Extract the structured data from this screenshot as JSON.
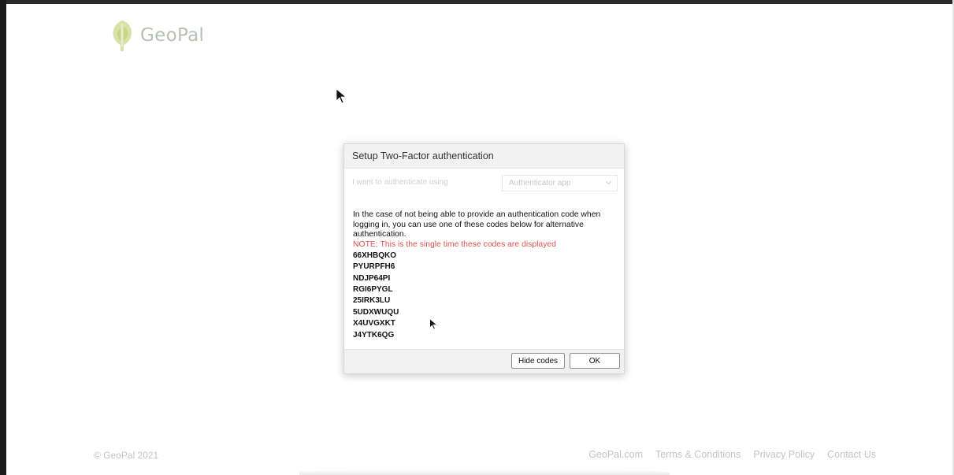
{
  "brand": {
    "logo_text": "GeoPal",
    "logo_color": "#b9bfb4"
  },
  "dialog": {
    "title": "Setup Two-Factor authentication",
    "auth_label": "I want to authenticate using",
    "auth_method": "Authenticator app",
    "body_text": "In the case of not being able to provide an authentication code when logging in, you can use one of these codes below for alternative authentication.",
    "note": "NOTE: This is the single time these codes are displayed",
    "note_color": "#d9534f",
    "codes": [
      "66XHBQKO",
      "PYURPFH6",
      "NDJP64PI",
      "RGI6PYGL",
      "25IRK3LU",
      "5UDXWUQU",
      "X4UVGXKT",
      "J4YTK6QG"
    ],
    "hide_codes_label": "Hide codes",
    "ok_label": "OK"
  },
  "footer": {
    "copyright": "© GeoPal 2021",
    "links": [
      "GeoPal.com",
      "Terms & Conditions",
      "Privacy Policy",
      "Contact Us"
    ]
  }
}
